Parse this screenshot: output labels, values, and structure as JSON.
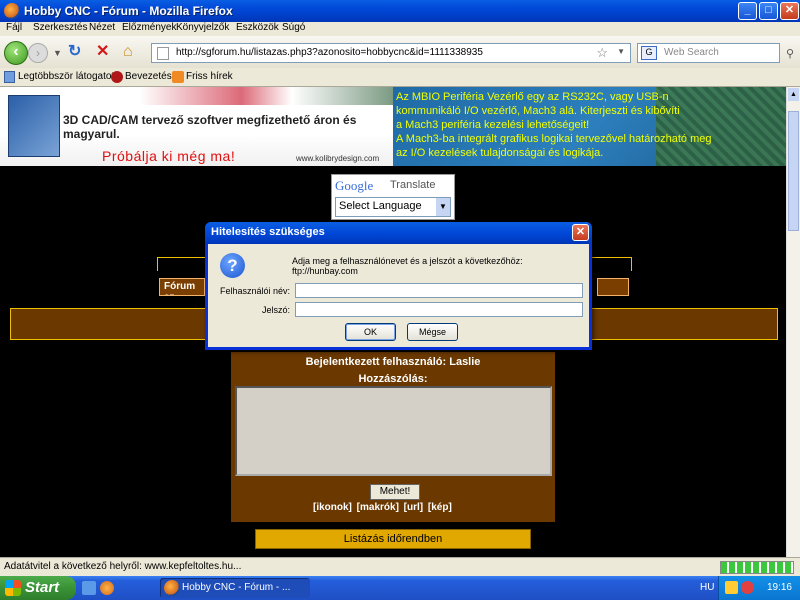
{
  "window": {
    "title": "Hobby CNC - Fórum - Mozilla Firefox",
    "minimize": "_",
    "maximize": "□",
    "close": "✕"
  },
  "menu": [
    "Fájl",
    "Szerkesztés",
    "Nézet",
    "Előzmények",
    "Könyvjelzők",
    "Eszközök",
    "Súgó"
  ],
  "nav": {
    "url": "http://sgforum.hu/listazas.php3?azonosito=hobbycnc&id=1111338935",
    "search_placeholder": "Web Search",
    "back_icon": "arrow-left-icon",
    "forward_icon": "arrow-right-icon",
    "reload_icon": "reload-icon",
    "stop_icon": "stop-icon",
    "home_icon": "home-icon"
  },
  "bookmarks": [
    "Legtöbbször látogatott",
    "Bevezetés",
    "Friss hírek"
  ],
  "ad_left": {
    "headline": "3D CAD/CAM tervező szoftver megfizethető áron és magyarul.",
    "cta": "Próbálja ki még ma!",
    "site": "www.kolibrydesign.com"
  },
  "ad_right": {
    "lines": [
      "Az MBIO Periféria Vezérlő egy az RS232C, vagy USB-n",
      "kommunikáló I/O vezérlő, Mach3 alá. Kiterjeszti és kibővíti",
      "a Mach3 periféria kezelési lehetőségeit!",
      "A Mach3-ba integrált grafikus logikai tervezővel határozható meg",
      "az I/O kezelések tulajdonságai és logikája."
    ]
  },
  "translate": {
    "logo": "Google",
    "label": "Translate",
    "select": "Select Language"
  },
  "forum": {
    "button_label": "Fórum sz",
    "logged_in": "Bejelentkezett felhasználó: Laslie",
    "comment_label": "Hozzászólás:",
    "send": "Mehet!",
    "links": "[ikonok] [makrók] [url] [kép]",
    "list_button": "Listázás időrendben"
  },
  "dialog": {
    "title": "Hitelesítés szükséges",
    "message": "Adja meg a felhasználónevet és a jelszót a következőhöz: ftp://hunbay.com",
    "username_label": "Felhasználói név:",
    "username_value": "",
    "password_label": "Jelszó:",
    "password_value": "",
    "ok": "OK",
    "cancel": "Mégse"
  },
  "status": {
    "text": "Adatátvitel a következő helyről: www.kepfeltoltes.hu...",
    "progress": 1.0
  },
  "taskbar": {
    "start": "Start",
    "task": "Hobby CNC - Fórum - ...",
    "lang": "HU",
    "clock": "19:16"
  }
}
